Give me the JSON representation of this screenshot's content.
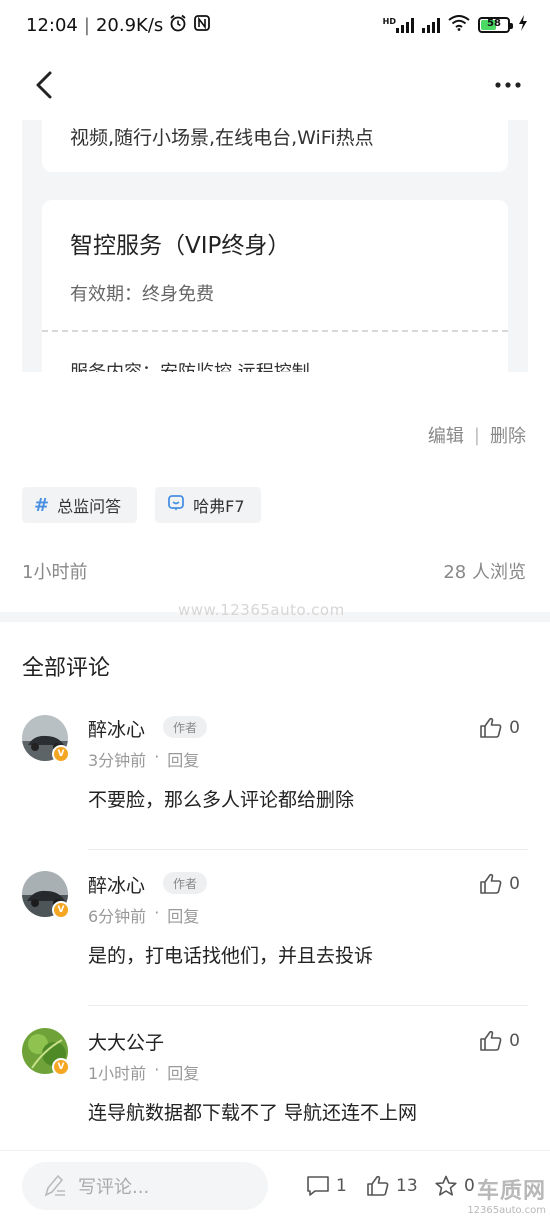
{
  "status_bar": {
    "time": "12:04",
    "speed": "20.9K/s",
    "battery": "58"
  },
  "article": {
    "card1_text": "视频,随行小场景,在线电台,WiFi热点",
    "card2_title": "智控服务（VIP终身）",
    "card2_validity": "有效期：终身免费",
    "card2_content": "服务内容：安防监控,远程控制"
  },
  "actions": {
    "edit": "编辑",
    "separator": "|",
    "delete": "删除"
  },
  "tags": [
    {
      "label": "总监问答",
      "icon": "hash-icon"
    },
    {
      "label": "哈弗F7",
      "icon": "chat-icon"
    }
  ],
  "meta": {
    "time": "1小时前",
    "views": "28 人浏览"
  },
  "watermark": "www.12365auto.com",
  "comments_title": "全部评论",
  "comments": [
    {
      "name": "醉冰心",
      "author_tag": "作者",
      "time": "3分钟前",
      "dot": "·",
      "reply": "回复",
      "text": "不要脸，那么多人评论都给删除",
      "likes": "0",
      "badge": "V"
    },
    {
      "name": "醉冰心",
      "author_tag": "作者",
      "time": "6分钟前",
      "dot": "·",
      "reply": "回复",
      "text": "是的，打电话找他们，并且去投诉",
      "likes": "0",
      "badge": "V"
    },
    {
      "name": "大大公子",
      "author_tag": "",
      "time": "1小时前",
      "dot": "·",
      "reply": "回复",
      "text": "连导航数据都下载不了  导航还连不上网",
      "likes": "0",
      "badge": "V"
    }
  ],
  "bottom_bar": {
    "input_placeholder": "写评论...",
    "comment_count": "1",
    "like_count": "13",
    "favorite_count": "0",
    "logo_line1": "车质网",
    "logo_line2": "12365auto.com"
  }
}
